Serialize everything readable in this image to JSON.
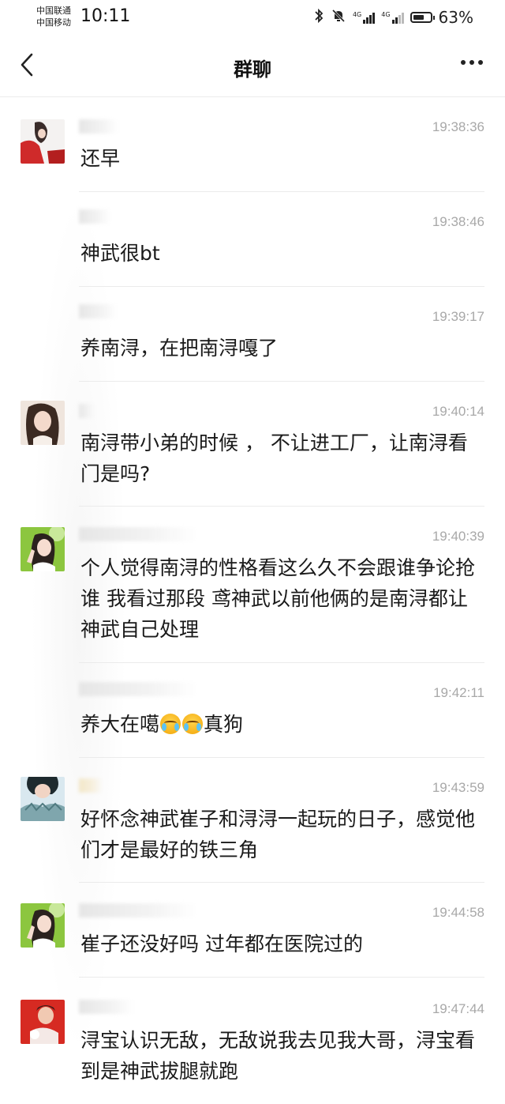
{
  "status_bar": {
    "carrier_1": "中国联通",
    "carrier_2": "中国移动",
    "time": "10:11",
    "network_1": "4G",
    "network_2": "4G",
    "battery_percent": "63%",
    "battery_level": 0.63,
    "icons": [
      "bluetooth-icon",
      "mute-icon",
      "signal-icon",
      "signal-icon",
      "battery-icon"
    ]
  },
  "header": {
    "title": "群聊",
    "back_icon": "chevron-left-icon",
    "more_icon": "more-dots-icon"
  },
  "messages": [
    {
      "time": "19:38:36",
      "text": "还早"
    },
    {
      "time": "19:38:46",
      "text": "神武很bt"
    },
    {
      "time": "19:39:17",
      "text": "养南浔，在把南浔嘎了"
    },
    {
      "time": "19:40:14",
      "text": "南浔带小弟的时候 ， 不让进工厂，让南浔看门是吗?"
    },
    {
      "time": "19:40:39",
      "text": "个人觉得南浔的性格看这么久不会跟谁争论抢谁  我看过那段 鸢神武以前他俩的是南浔都让神武自己处理"
    },
    {
      "time": "19:42:11",
      "text_before": "养大在噶",
      "emoji": "crying-laughing-emoji",
      "emoji_count": 2,
      "text_after": "真狗"
    },
    {
      "time": "19:43:59",
      "text": "好怀念神武崔子和浔浔一起玩的日子，感觉他们才是最好的铁三角"
    },
    {
      "time": "19:44:58",
      "text": "崔子还没好吗 过年都在医院过的"
    },
    {
      "time": "19:47:44",
      "text": "浔宝认识无敌，无敌说我去见我大哥，浔宝看到是神武拔腿就跑"
    }
  ]
}
